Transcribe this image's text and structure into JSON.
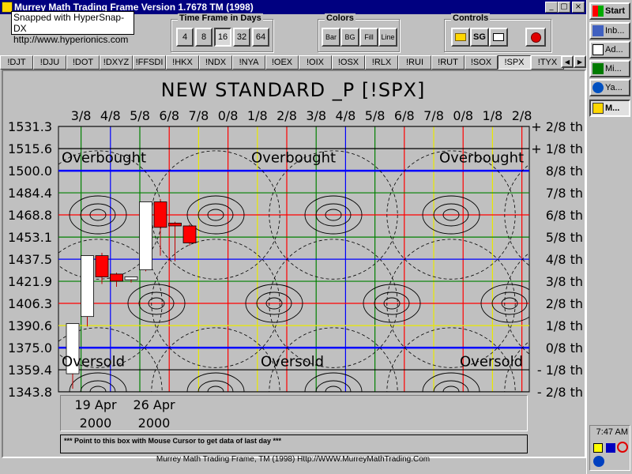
{
  "window": {
    "title": "Murrey Math Trading Frame Version 1.7678  TM (1998)",
    "min": "_",
    "max": "▢",
    "close": "×"
  },
  "snap": {
    "line1": "Snapped with HyperSnap-DX",
    "line2": "http://www.hyperionics.com"
  },
  "timeframe": {
    "label": "Time Frame in Days",
    "options": [
      "4",
      "8",
      "16",
      "32",
      "64"
    ],
    "selected": "16"
  },
  "colors": {
    "label": "Colors",
    "options": [
      "Bar",
      "BG",
      "Fill",
      "Line"
    ]
  },
  "controls": {
    "label": "Controls",
    "sg": "SG"
  },
  "tabs": [
    "!DJT",
    "!DJU",
    "!DOT",
    "!DXYZ",
    "!FFSDI",
    "!HKX",
    "!NDX",
    "!NYA",
    "!OEX",
    "!OIX",
    "!OSX",
    "!RLX",
    "!RUI",
    "!RUT",
    "!SOX",
    "!SPX",
    "!TYX"
  ],
  "active_tab": "!SPX",
  "tab_scroll": {
    "left": "◀",
    "right": "▶"
  },
  "chart": {
    "title": "NEW STANDARD _P [!SPX]",
    "top_labels": [
      "3/8",
      "4/8",
      "5/8",
      "6/8",
      "7/8",
      "0/8",
      "1/8",
      "2/8",
      "3/8",
      "4/8",
      "5/8",
      "6/8",
      "7/8",
      "0/8",
      "1/8",
      "2/8"
    ],
    "price_labels": [
      "1531.3",
      "1515.6",
      "1500.0",
      "1484.4",
      "1468.8",
      "1453.1",
      "1437.5",
      "1421.9",
      "1406.3",
      "1390.6",
      "1375.0",
      "1359.4",
      "1343.8"
    ],
    "right_labels": [
      "+ 2/8 th",
      "+ 1/8 th",
      "8/8 th",
      "7/8 th",
      "6/8 th",
      "5/8 th",
      "4/8 th",
      "3/8 th",
      "2/8 th",
      "1/8 th",
      "0/8 th",
      "- 1/8 th",
      "- 2/8 th"
    ],
    "overbought": "Overbought",
    "oversold": "Oversold",
    "dates": [
      {
        "day": "19 Apr",
        "year": "2000"
      },
      {
        "day": "26 Apr",
        "year": "2000"
      }
    ],
    "hint": "*** Point to this box with Mouse Cursor to get data of last day ***",
    "colors": {
      "bg": "#c0c0c0",
      "blue": "#0000ff",
      "red": "#ff0000",
      "green": "#008000",
      "yellow": "#e8e800",
      "up": "#ffffff",
      "down": "#ff0000"
    }
  },
  "chart_data": {
    "type": "candlestick",
    "title": "NEW STANDARD _P [!SPX]",
    "y_ticks": [
      1531.3,
      1515.6,
      1500.0,
      1484.4,
      1468.8,
      1453.1,
      1437.5,
      1421.9,
      1406.3,
      1390.6,
      1375.0,
      1359.4,
      1343.8
    ],
    "ylim": [
      1343.8,
      1531.3
    ],
    "x_labels": [
      {
        "index": 0,
        "label": "19 Apr 2000"
      },
      {
        "index": 4,
        "label": "26 Apr 2000"
      }
    ],
    "candles": [
      {
        "index": 0,
        "open": 1356.6,
        "high": 1392.0,
        "low": 1346.0,
        "close": 1392.0
      },
      {
        "index": 1,
        "open": 1397.0,
        "high": 1440.0,
        "low": 1390.0,
        "close": 1440.0
      },
      {
        "index": 2,
        "open": 1440.0,
        "high": 1442.0,
        "low": 1420.0,
        "close": 1425.0
      },
      {
        "index": 3,
        "open": 1427.0,
        "high": 1428.0,
        "low": 1418.0,
        "close": 1422.0
      },
      {
        "index": 4,
        "open": 1423.0,
        "high": 1425.0,
        "low": 1421.0,
        "close": 1425.0
      },
      {
        "index": 5,
        "open": 1430.0,
        "high": 1478.0,
        "low": 1429.0,
        "close": 1478.0
      },
      {
        "index": 6,
        "open": 1478.0,
        "high": 1480.0,
        "low": 1440.0,
        "close": 1460.0
      },
      {
        "index": 7,
        "open": 1463.0,
        "high": 1464.0,
        "low": 1436.0,
        "close": 1461.0
      },
      {
        "index": 8,
        "open": 1461.0,
        "high": 1462.0,
        "low": 1447.0,
        "close": 1449.0
      }
    ]
  },
  "footer": "Murrey Math Trading Frame, TM (1998) Http://WWW.MurreyMathTrading.Com",
  "taskbar": {
    "start": "Start",
    "items": [
      "Inb...",
      "Ad...",
      "Mi...",
      "Ya...",
      "M..."
    ],
    "active": "M...",
    "clock": "7:47 AM"
  }
}
